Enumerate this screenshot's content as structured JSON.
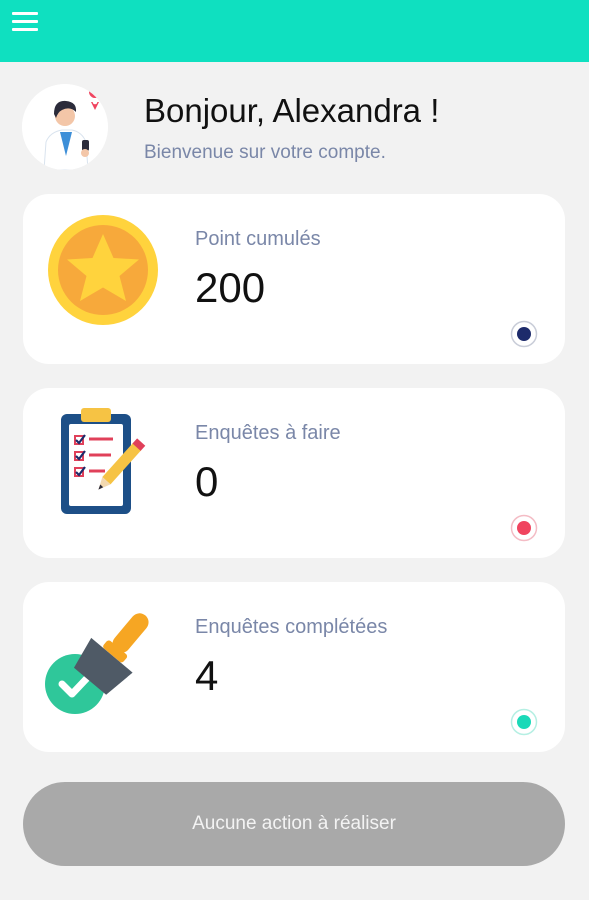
{
  "header": {
    "menu_icon": "hamburger-menu-icon",
    "bg_color": "#0fe0c0"
  },
  "greeting": {
    "title": "Bonjour, Alexandra !",
    "subtitle": "Bienvenue sur votre compte.",
    "avatar_icon": "doctor-avatar-icon"
  },
  "cards": [
    {
      "label": "Point cumulés",
      "value": "200",
      "icon": "gold-star-coin-icon",
      "dot_color": "#1d2b6b"
    },
    {
      "label": "Enquêtes à faire",
      "value": "0",
      "icon": "clipboard-checklist-icon",
      "dot_color": "#f0445f"
    },
    {
      "label": "Enquêtes complétées",
      "value": "4",
      "icon": "approval-stamp-icon",
      "dot_color": "#1ad9b8"
    }
  ],
  "action": {
    "label": "Aucune action à réaliser",
    "bg_color": "#a9a9a9"
  }
}
